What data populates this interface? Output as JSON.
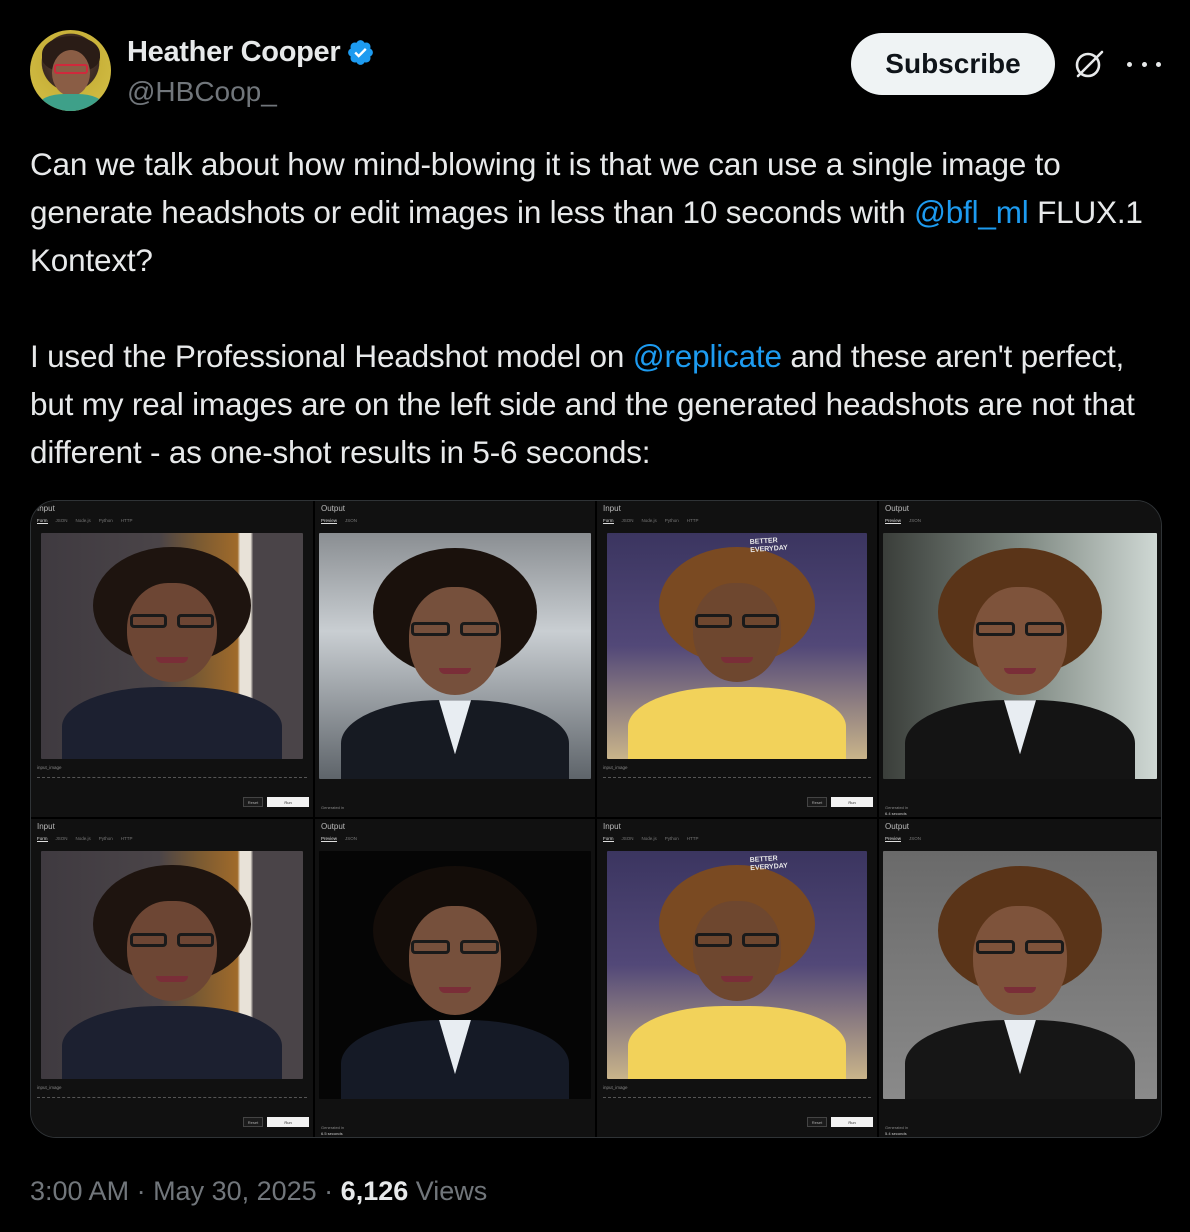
{
  "author": {
    "name": "Heather Cooper",
    "handle": "@HBCoop_",
    "verified_color": "#1d9bf0"
  },
  "actions": {
    "subscribe_label": "Subscribe",
    "grok_icon": "grok-icon",
    "more_icon": "more-icon"
  },
  "tweet": {
    "p1_before": "Can we talk about how mind-blowing it is that we can use a single image to generate headshots or edit images in less than 10 seconds with ",
    "p1_mention": "@bfl_ml",
    "p1_after": " FLUX.1 Kontext?",
    "p2_before": "I used the Professional Headshot model on ",
    "p2_mention": "@replicate",
    "p2_after": " and these aren't perfect, but my real images are on the left side and the generated headshots are not that different - as one-shot results in 5-6 seconds:"
  },
  "media": {
    "panels": [
      {
        "title": "Input",
        "tabs": [
          "Form",
          "JSON",
          "Node.js",
          "Python",
          "HTTP"
        ],
        "field": "input_image",
        "reset": "Reset",
        "run": "Run"
      },
      {
        "title": "Output",
        "tabs": [
          "Preview",
          "JSON"
        ],
        "generated": "Generated in"
      },
      {
        "title": "Input",
        "tabs": [
          "Form",
          "JSON",
          "Node.js",
          "Python",
          "HTTP"
        ],
        "field": "input_image",
        "reset": "Reset",
        "run": "Run",
        "poster": "BETTER EVERYDAY"
      },
      {
        "title": "Output",
        "tabs": [
          "Preview",
          "JSON"
        ],
        "generated": "Generated in",
        "time": "6.4 seconds"
      },
      {
        "title": "Input",
        "tabs": [
          "Form",
          "JSON",
          "Node.js",
          "Python",
          "HTTP"
        ],
        "field": "input_image",
        "reset": "Reset",
        "run": "Run"
      },
      {
        "title": "Output",
        "tabs": [
          "Preview",
          "JSON"
        ],
        "generated": "Generated in",
        "time": "6.5 seconds"
      },
      {
        "title": "Input",
        "tabs": [
          "Form",
          "JSON",
          "Node.js",
          "Python",
          "HTTP"
        ],
        "field": "input_image",
        "reset": "Reset",
        "run": "Run",
        "poster": "BETTER EVERYDAY"
      },
      {
        "title": "Output",
        "tabs": [
          "Preview",
          "JSON"
        ],
        "generated": "Generated in",
        "time": "5.4 seconds"
      }
    ]
  },
  "meta": {
    "time": "3:00 AM",
    "sep1": " · ",
    "date": "May 30, 2025",
    "sep2": " · ",
    "views_count": "6,126",
    "views_label": " Views"
  }
}
